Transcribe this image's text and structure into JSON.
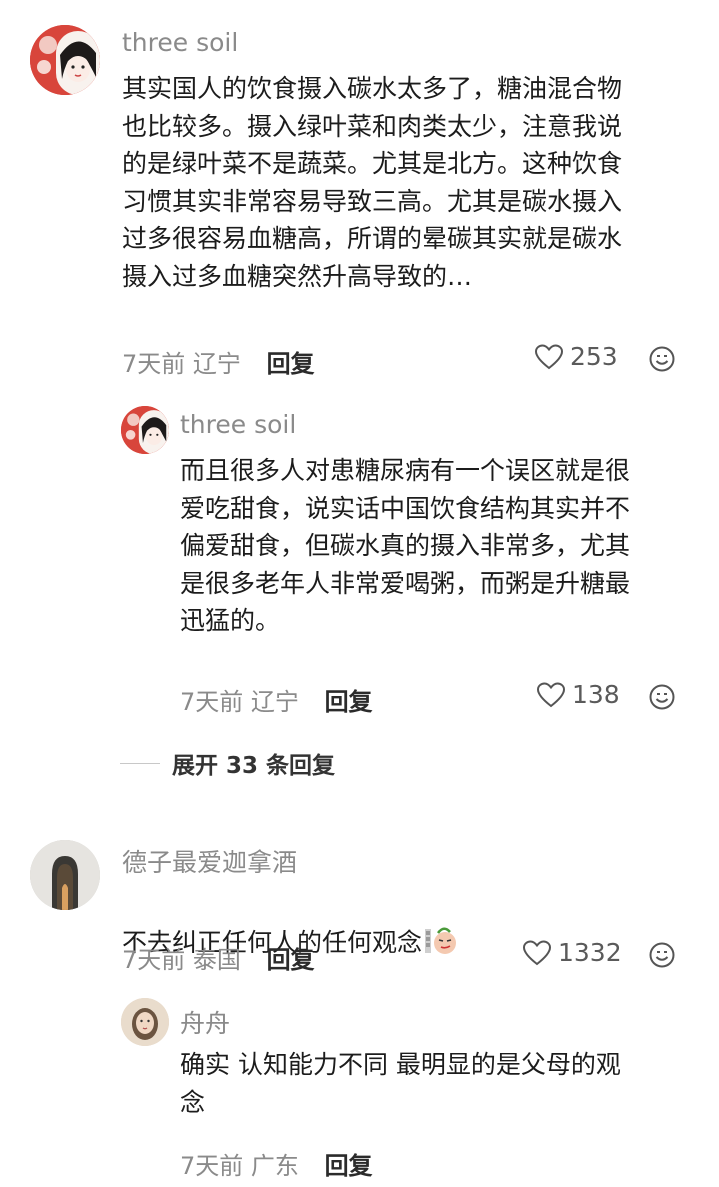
{
  "comments": [
    {
      "user": "three soil",
      "text": "其实国人的饮食摄入碳水太多了，糖油混合物\n也比较多。摄入绿叶菜和肉类太少，注意我说\n的是绿叶菜不是蔬菜。尤其是北方。这种饮食\n习惯其实非常容易导致三高。尤其是碳水摄入\n过多很容易血糖高，所谓的晕碳其实就是碳水\n摄入过多血糖突然升高导致的…",
      "time": "7天前",
      "location": "辽宁",
      "reply_label": "回复",
      "likes": "253",
      "replies": [
        {
          "user": "three soil",
          "text": "而且很多人对患糖尿病有一个误区就是很\n爱吃甜食，说实话中国饮食结构其实并不\n偏爱甜食，但碳水真的摄入非常多，尤其\n是很多老年人非常爱喝粥，而粥是升糖最\n迅猛的。",
          "time": "7天前",
          "location": "辽宁",
          "reply_label": "回复",
          "likes": "138"
        }
      ],
      "expand_label": "展开 33 条回复"
    },
    {
      "user": "德子最爱迦拿酒",
      "text": "不去纠正任何人的任何观念",
      "time": "7天前",
      "location": "泰国",
      "reply_label": "回复",
      "likes": "1332",
      "replies": [
        {
          "user": "舟舟",
          "text": "确实 认知能力不同 最明显的是父母的观\n念",
          "time": "7天前",
          "location": "广东",
          "reply_label": "回复"
        }
      ]
    }
  ],
  "icons": {
    "like": "heart-outline-icon",
    "emoji": "smiley-icon"
  },
  "colors": {
    "text": "#1c1c1c",
    "meta": "#8a8a8a",
    "avatar_red": "#d8453b"
  }
}
